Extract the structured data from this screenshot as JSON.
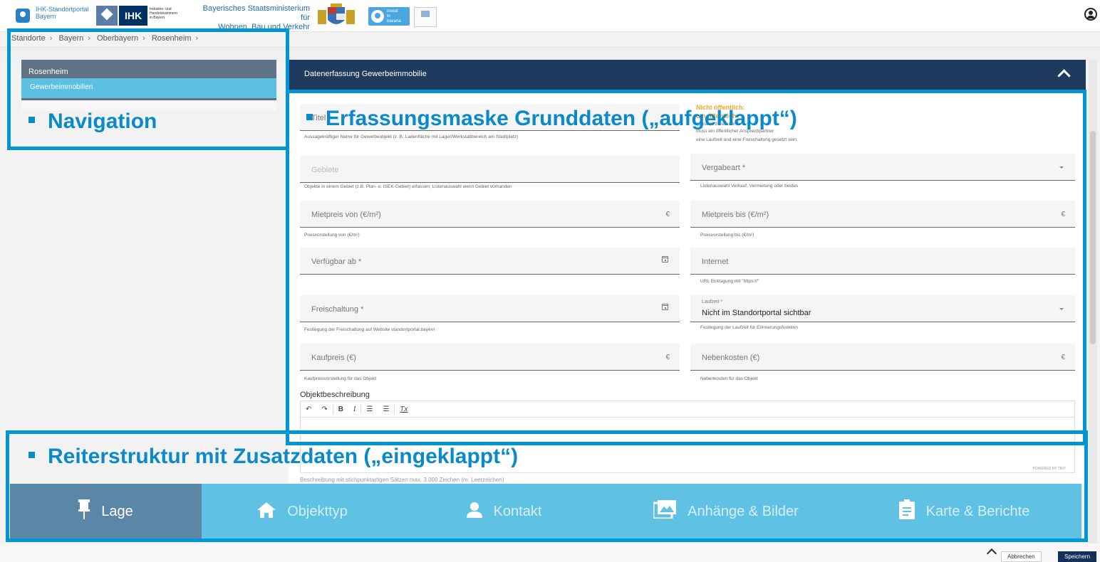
{
  "header": {
    "portal_line1": "IHK-Standortportal",
    "portal_line2": "Bayern",
    "ihk_logo": "IHK",
    "ihk_sub_line1": "Industrie- und Handelskammern",
    "ihk_sub_line2": "in Bayern",
    "ministry_line1": "Bayerisches Staatsministerium für",
    "ministry_line2": "Wohnen, Bau und Verkehr",
    "invest_line1": "invest",
    "invest_line2": "in",
    "invest_line3": "bavaria",
    "user_icon": "user-icon"
  },
  "breadcrumb": [
    "Standorte",
    "Bayern",
    "Oberbayern",
    "Rosenheim"
  ],
  "breadcrumb_separator": "›",
  "nav": {
    "header": "Rosenheim",
    "item": "Gewerbeimmobilien"
  },
  "main": {
    "title": "Datenerfassung Gewerbeimmobilie"
  },
  "form": {
    "titel_label": "Titel *",
    "titel_hint": "Aussagekräftiger Name für Gewerbeobjekt (z. B. Ladenfläche mit Lager/Werkstattbereich am Stadtplatz)",
    "notice_line1": "Nicht öffentlich:",
    "notice_line2": "um öffentlich",
    "notice_hint_line1": "gemacht zu werden",
    "notice_hint_line2": "muss ein öffentlicher Ansprechpartner",
    "notice_hint_line3": "eine Laufzeit und eine Freischaltung gesetzt sein.",
    "gebiete_label": "Gebiete",
    "gebiete_hint": "Objekte in einem Gebiet (z.B. Plan- o. ISEK-Gebiet) erfassen, Listenauswahl wenn Gebiet vorhanden",
    "vergabeart_label": "Vergabeart *",
    "vergabeart_hint": "Listenauswahl Verkauf, Vermietung oder beides",
    "mietpreis_von_label": "Mietpreis von (€/m²)",
    "mietpreis_von_hint": "Preisvorstellung von (€/m²)",
    "mietpreis_bis_label": "Mietpreis bis (€/m²)",
    "mietpreis_bis_hint": "Preisvorstellung bis (€/m²)",
    "currency_suffix": "€",
    "verfuegbar_label": "Verfügbar ab *",
    "internet_label": "Internet",
    "internet_hint": "URL Eintragung mit \"https://\"",
    "freischaltung_label": "Freischaltung *",
    "freischaltung_hint": "Festlegung der Freischaltung auf Website standortportal.bayern",
    "laufzeit_label": "Laufzeit *",
    "laufzeit_value": "Nicht im Standortportal sichtbar",
    "laufzeit_hint": "Festlegung der Laufzeit für Erinnerungsfunktion",
    "kaufpreis_label": "Kaufpreis (€)",
    "kaufpreis_hint": "Kaufpreisvorstellung für das Objekt",
    "nebenkosten_label": "Nebenkosten (€)",
    "nebenkosten_hint": "Nebenkosten für das Objekt",
    "description_title": "Objektbeschreibung",
    "description_hint": "Beschreibung mit stichpunktartigen Sätzen max. 3.000 Zeichen (m. Leerzeichen)",
    "powered_by": "POWERED BY TINY"
  },
  "editor_toolbar": {
    "undo": "↶",
    "redo": "↷",
    "bold": "B",
    "italic": "I",
    "bullet_list": "☰",
    "numbered_list": "☰",
    "clear_format": "Tx"
  },
  "tabs": [
    {
      "label": "Lage",
      "icon": "pin-icon",
      "glyph": "📌"
    },
    {
      "label": "Objekttyp",
      "icon": "home-icon",
      "glyph": "⌂"
    },
    {
      "label": "Kontakt",
      "icon": "person-icon",
      "glyph": "👤"
    },
    {
      "label": "Anhänge & Bilder",
      "icon": "images-icon",
      "glyph": "🖼"
    },
    {
      "label": "Karte & Berichte",
      "icon": "clipboard-icon",
      "glyph": "📋"
    }
  ],
  "footer": {
    "cancel": "Abbrechen",
    "save": "Speichern"
  },
  "annotations": {
    "navigation": "Navigation",
    "grunddaten": "Erfassungsmaske Grunddaten („aufgeklappt“)",
    "reiter": "Reiterstruktur mit Zusatzdaten („eingeklappt“)"
  },
  "colors": {
    "header_navy": "#1f3a5f",
    "nav_blue": "#5bc0e3",
    "annotation_blue": "#0096d6",
    "notice_orange": "#f4a52a",
    "save_button": "#12305a"
  }
}
